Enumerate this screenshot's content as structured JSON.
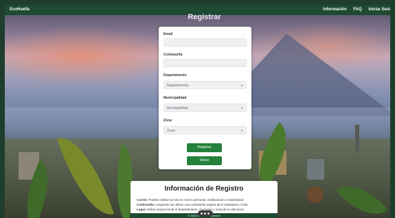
{
  "nav": {
    "brand": "EcoHuella",
    "links": [
      "Información",
      "FAQ",
      "Iniciar Sesi"
    ]
  },
  "page_title": "Registrar",
  "form": {
    "email_label": "Email",
    "email_value": "",
    "password_label": "Contraseña",
    "password_value": "",
    "department_label": "Departamento",
    "department_value": "Departamento",
    "municipality_label": "Municipalidad",
    "municipality_value": "Municipalidad",
    "zone_label": "Zona",
    "zone_value": "Zona",
    "submit_label": "Registrar",
    "back_label": "Volver"
  },
  "info": {
    "title": "Información de Registro",
    "lines": [
      {
        "term": "Correo:",
        "text": " Puedes utilizar ya sea un correo personal, institucional o empresarial."
      },
      {
        "term": "Contraseña:",
        "text": " Asegúrate de utilizar una contraseña segura de 8 caracteres o más."
      },
      {
        "term": "Lugar:",
        "text": " Debes proporcionar el departamento, municipio y zona de tu ubicación."
      }
    ]
  },
  "footer": {
    "text": "© 2024 Huella de Carbono"
  },
  "colors": {
    "nav": "#1f4a32",
    "button": "#25803b"
  }
}
